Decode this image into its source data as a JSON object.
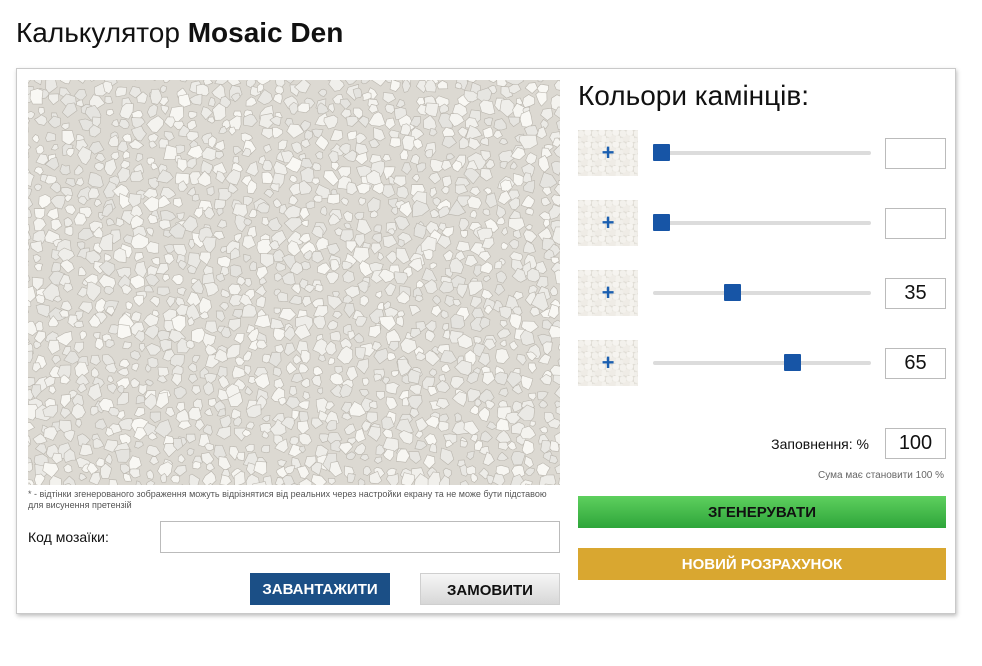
{
  "header": {
    "title_prefix": "Калькулятор",
    "title_brand": "Mosaic Den"
  },
  "preview": {
    "disclaimer": "* - відтінки згенерованого зображення можуть відрізнятися від реальних через настройки екрану та не може бути підставою для висунення претензій"
  },
  "code": {
    "label": "Код мозаїки:",
    "value": "",
    "placeholder": ""
  },
  "buttons": {
    "download": "ЗАВАНТАЖИТИ",
    "order": "ЗАМОВИТИ",
    "generate": "ЗГЕНЕРУВАТИ",
    "new_calc": "НОВИЙ РОЗРАХУНОК"
  },
  "colors": {
    "title": "Кольори камінців:",
    "add_symbol": "+",
    "rows": [
      {
        "value": "",
        "level": 0
      },
      {
        "value": "",
        "level": 0
      },
      {
        "value": "35",
        "level": 35
      },
      {
        "value": "65",
        "level": 65
      }
    ]
  },
  "fill": {
    "label": "Заповнення: %",
    "value": "100",
    "note": "Сума має становити 100 %"
  },
  "theme": {
    "accent_blue": "#1b4f86",
    "slider_thumb": "#1755a6",
    "generate_green": "#3dbb48",
    "new_calc_gold": "#d9a730",
    "stone_base": "#dcd9d2"
  }
}
